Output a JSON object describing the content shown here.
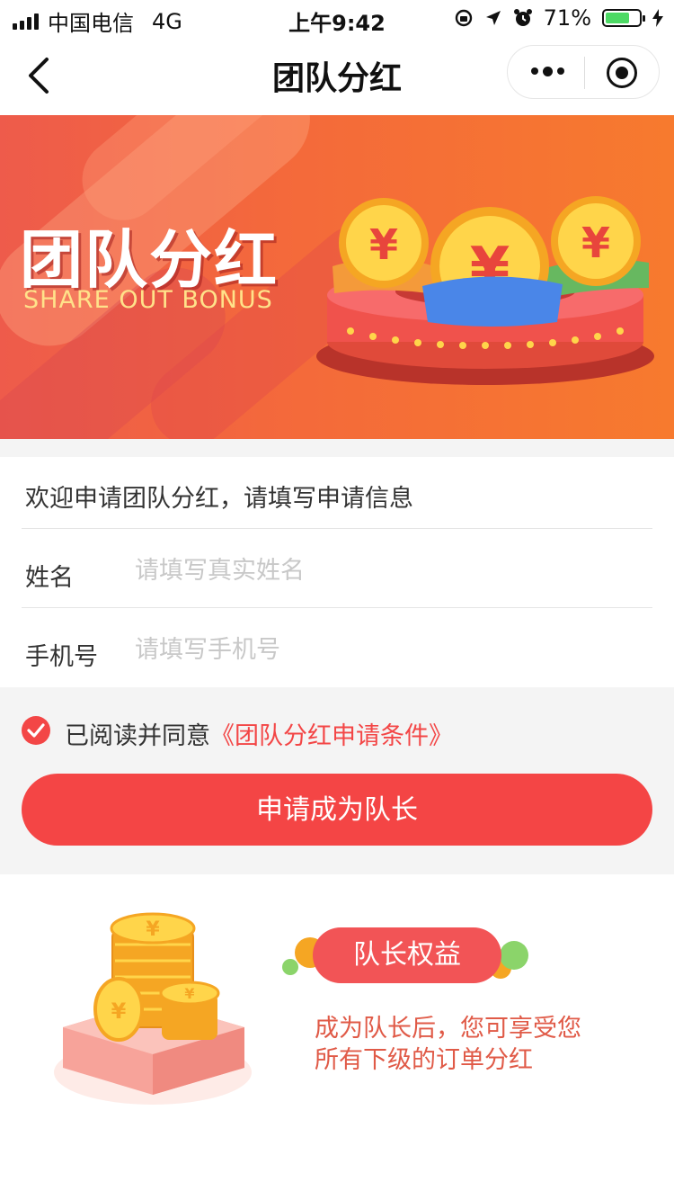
{
  "status_bar": {
    "carrier": "中国电信",
    "network": "4G",
    "time": "上午9:42",
    "battery_percent": "71%",
    "battery_level": 0.71
  },
  "nav": {
    "title": "团队分红",
    "back_icon": "chevron-left-icon",
    "more_icon": "more-dots-icon",
    "close_icon": "target-circle-icon"
  },
  "banner": {
    "title": "团队分红",
    "subtitle": "SHARE OUT BONUS",
    "coin_symbol": "¥"
  },
  "form": {
    "welcome": "欢迎申请团队分红，请填写申请信息",
    "name_label": "姓名",
    "name_placeholder": "请填写真实姓名",
    "phone_label": "手机号",
    "phone_placeholder": "请填写手机号"
  },
  "agreement": {
    "text": "已阅读并同意",
    "link": "《团队分红申请条件》",
    "checked": true
  },
  "apply_button": "申请成为队长",
  "rights": {
    "badge": "队长权益",
    "line1": "成为队长后，您可享受您",
    "line2": "所有下级的订单分红"
  },
  "colors": {
    "accent": "#f44545",
    "banner_start": "#ee5b4b",
    "banner_end": "#f77a2e",
    "subtitle": "#ffe28a",
    "desc": "#e05a47"
  }
}
